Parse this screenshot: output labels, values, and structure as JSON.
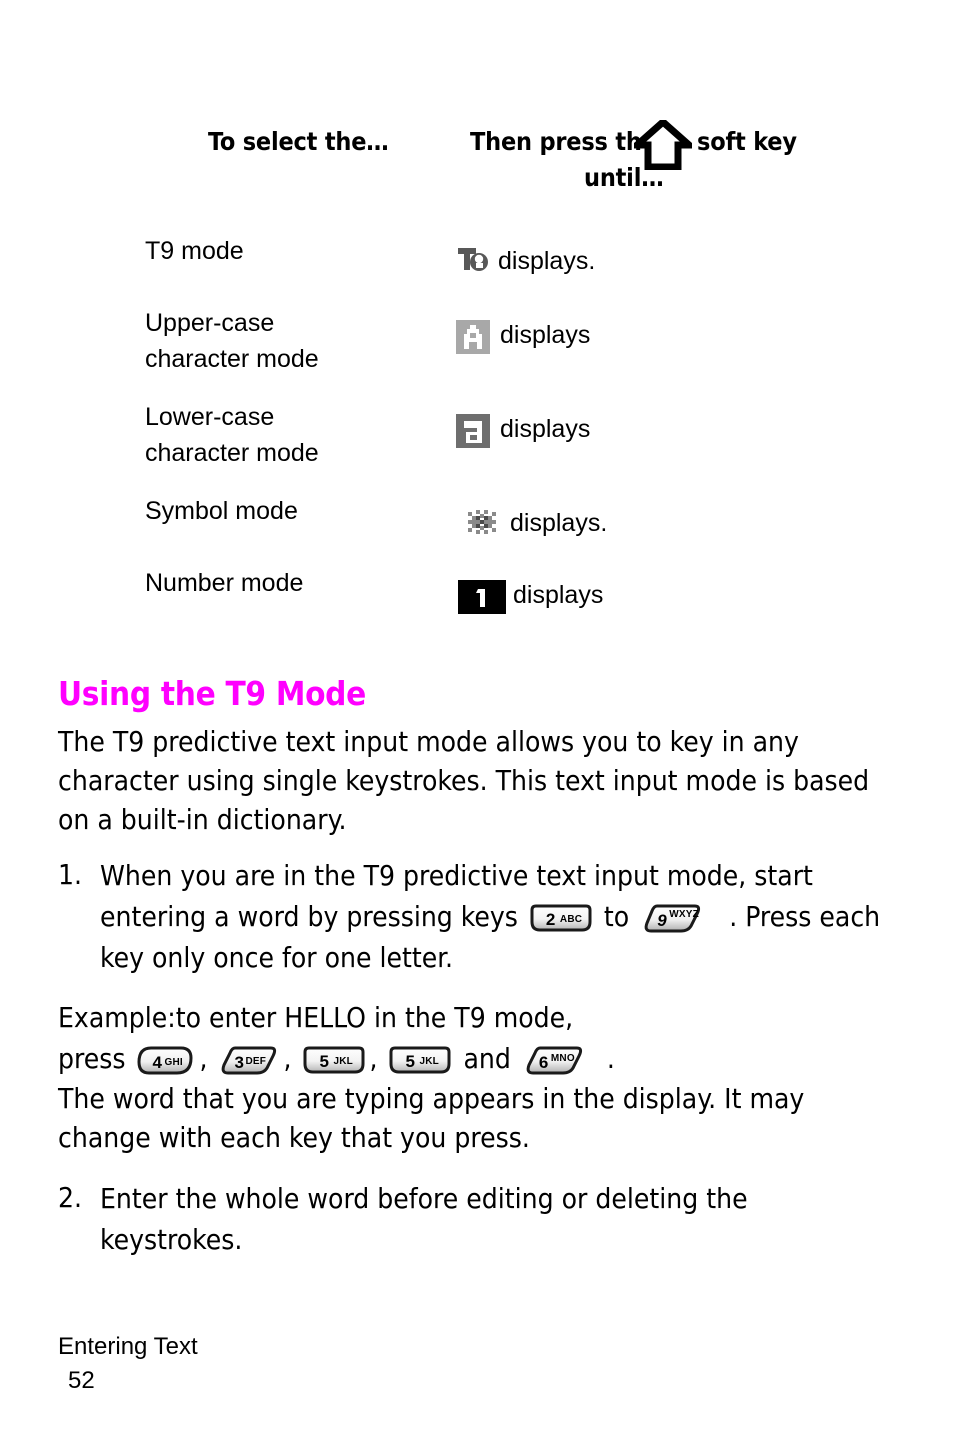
{
  "page": {
    "footer_section": "Entering Text",
    "footer_page_number": "52"
  },
  "mode_table": {
    "header": {
      "col1": "To select the…",
      "col2_before_icon": "Then press the",
      "col2_after_icon": "soft key",
      "col2_second_line": "until…",
      "icon": "up-arrow-soft-key-icon"
    },
    "rows": [
      {
        "label": "T9 mode",
        "icon": "t9-mode-indicator-icon",
        "icon_glyph": "T9",
        "description": "displays."
      },
      {
        "label": "Upper-case\ncharacter mode",
        "icon": "upper-case-indicator-icon",
        "icon_glyph": "A",
        "description": "displays"
      },
      {
        "label": "Lower-case\ncharacter mode",
        "icon": "lower-case-indicator-icon",
        "icon_glyph": "a",
        "description": "displays"
      },
      {
        "label": "Symbol mode",
        "icon": "symbol-mode-indicator-icon",
        "icon_glyph": "",
        "description": "displays."
      },
      {
        "label": "Number mode",
        "icon": "number-mode-indicator-icon",
        "icon_glyph": "1",
        "description": "displays"
      }
    ]
  },
  "section": {
    "heading": "Using the T9 Mode",
    "heading_color": "#FF00FF",
    "intro": "The T9 predictive text input mode allows you to key in any character using single keystrokes. This text input mode is based on a built-in dictionary."
  },
  "steps": [
    {
      "number": "1.",
      "text_part_1": "When you are in the T9 predictive text input mode, start entering a word by pressing keys",
      "text_part_2": "to",
      "text_part_3": ".",
      "text_part_4": "Press each key only once for one letter.",
      "key_1": {
        "digit": "2",
        "letters": "ABC"
      },
      "key_2": {
        "digit": "9",
        "letters": "WXYZ"
      }
    },
    {
      "number": "2.",
      "text": "Enter the whole word before editing or deleting the keystrokes."
    }
  ],
  "example": {
    "line1": "Example:to enter HELLO in the T9 mode,",
    "press_label": "press",
    "sep": ",",
    "and_label": "and",
    "end": ".",
    "keys": [
      {
        "digit": "4",
        "letters": "GHI"
      },
      {
        "digit": "3",
        "letters": "DEF"
      },
      {
        "digit": "5",
        "letters": "JKL"
      },
      {
        "digit": "5",
        "letters": "JKL"
      },
      {
        "digit": "6",
        "letters": "MNO"
      }
    ]
  },
  "closing": "The word that you are typing appears in the display. It may change with each key that you press.",
  "colors": {
    "heading_magenta": "#FF00FF",
    "icon_upper_bg": "#A8A8A8",
    "icon_lower_bg": "#6E6E6E",
    "icon_number_bg": "#000000",
    "key_face_light": "#FFFFFF",
    "key_face_shadow": "#B4B4B4",
    "text_black": "#000000"
  }
}
